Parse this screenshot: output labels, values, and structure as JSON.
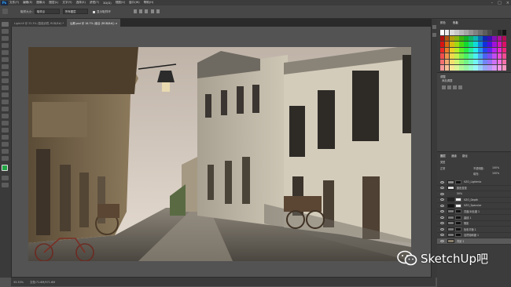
{
  "menu": {
    "app_logo": "Ps",
    "items": [
      "文件(F)",
      "编辑(E)",
      "图像(I)",
      "图层(L)",
      "文字(Y)",
      "选择(S)",
      "滤镜(T)",
      "3D(D)",
      "视图(V)",
      "窗口(W)",
      "帮助(H)"
    ]
  },
  "options_bar": {
    "sample_label": "取样大小:",
    "sample_value": "取样点",
    "sample_all": "所有图层",
    "show_ring": "显示取样环"
  },
  "tabs": [
    {
      "label": "Light.tif @ 33.3% (智能滤镜, RGB/8#) *",
      "close": "×"
    },
    {
      "label": "后期.psd @ 16.7% (组合 (RGB/8#)) ×",
      "close": "×"
    }
  ],
  "status": {
    "zoom": "33.33%",
    "doc": "文档:71.6M/571.6M"
  },
  "swatch_panel": {
    "tab_color": "颜色",
    "tab_swatch": "色板"
  },
  "adjust_panel": {
    "title": "调整",
    "subtitle": "添加调整"
  },
  "layers_panel": {
    "tab_layers": "图层",
    "tab_channels": "通道",
    "tab_paths": "路径",
    "kind_label": "类型",
    "blend_mode": "正常",
    "opacity_label": "不透明度:",
    "opacity_value": "100%",
    "fill_label": "填充:",
    "fill_value": "100%",
    "layers": [
      {
        "name": "VZO_Lightmix"
      },
      {
        "name": "颜色查找"
      },
      {
        "name": "50%"
      },
      {
        "name": "VZO_Depth"
      },
      {
        "name": "VZO_Specular"
      },
      {
        "name": "亮度/对比度 1"
      },
      {
        "name": "曲线 1"
      },
      {
        "name": "阴影"
      },
      {
        "name": "色彩平衡 1"
      },
      {
        "name": "自然饱和度 1"
      },
      {
        "name": "背景 2"
      }
    ]
  },
  "watermark": {
    "text": "SketchUp吧"
  },
  "colors": {
    "menubar_bg": "#3c3c3c",
    "workspace_bg": "#535353",
    "panel_bg": "#3c3c3c",
    "ps_blue": "#31a8ff",
    "foreground_color": "#22a644"
  },
  "icons": [
    "move-tool-icon",
    "marquee-icon",
    "lasso-icon",
    "crop-icon",
    "eyedropper-icon",
    "brush-icon",
    "stamp-icon",
    "eraser-icon",
    "gradient-icon",
    "pen-icon",
    "text-icon",
    "hand-icon",
    "zoom-icon",
    "eye-icon",
    "wechat-icon"
  ]
}
